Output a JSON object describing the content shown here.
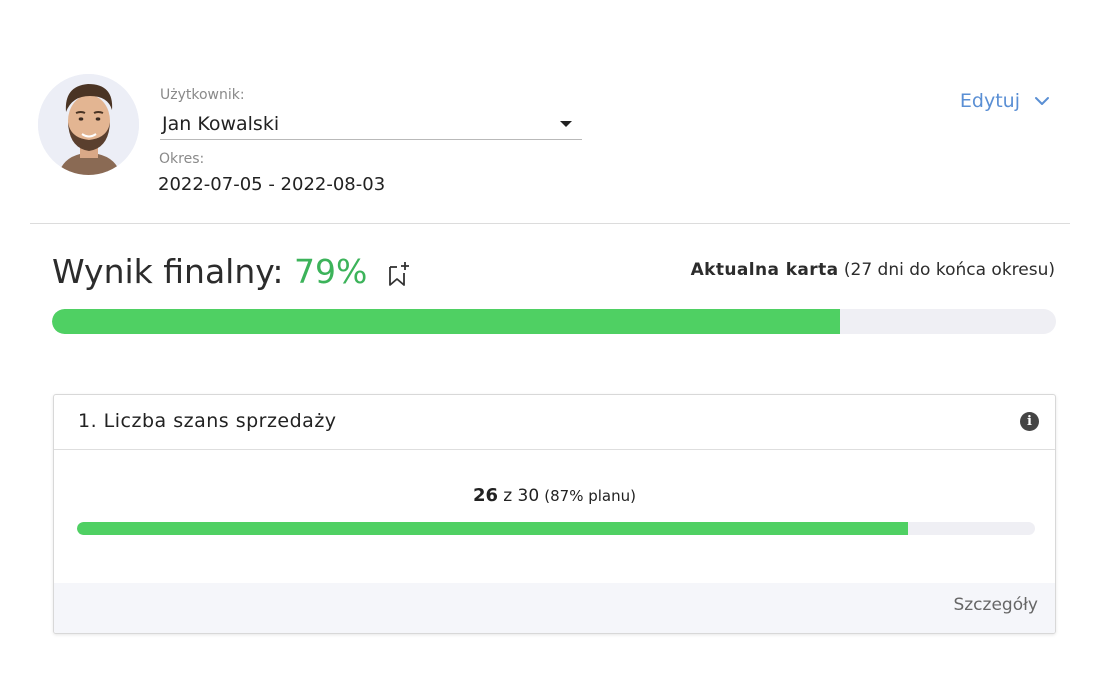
{
  "header": {
    "user_label": "Użytkownik:",
    "user_value": "Jan Kowalski",
    "period_label": "Okres:",
    "period_value": "2022-07-05 - 2022-08-03",
    "edit_label": "Edytuj"
  },
  "score": {
    "title": "Wynik finalny:",
    "percent_text": "79%",
    "progress": 0.785,
    "card_bold": "Aktualna karta",
    "card_note": "(27 dni do końca okresu)"
  },
  "kpi": {
    "title": "1. Liczba szans sprzedaży",
    "achieved": "26",
    "of_text": "z 30",
    "plan_text": "(87% planu)",
    "progress": 0.867,
    "details_label": "Szczegóły"
  },
  "colors": {
    "accent_green": "#4fd063",
    "percent_green": "#3cb35a",
    "link_blue": "#5a8fd4",
    "track": "#efeff4"
  },
  "icons": {
    "avatar": "user-photo",
    "dropdown": "caret-down-icon",
    "edit_chevron": "chevron-down-icon",
    "bookmark": "bookmark-add-icon",
    "info": "info-icon"
  }
}
